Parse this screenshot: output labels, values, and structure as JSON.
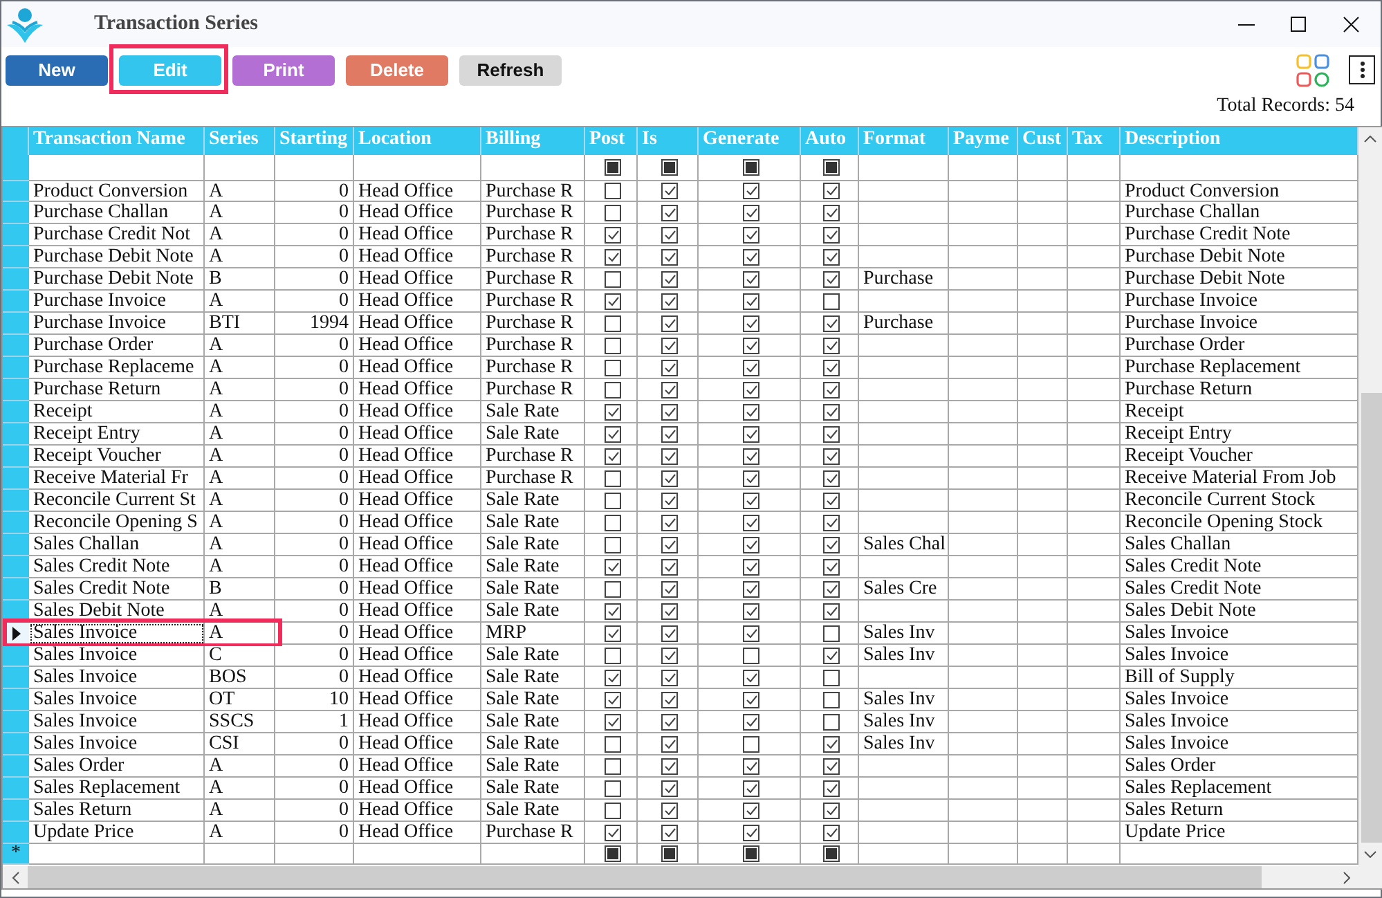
{
  "window": {
    "title": "Transaction Series"
  },
  "toolbar": {
    "buttons": [
      {
        "label": "New",
        "kind": "new",
        "highlighted": false
      },
      {
        "label": "Edit",
        "kind": "edit",
        "highlighted": true
      },
      {
        "label": "Print",
        "kind": "print",
        "highlighted": false
      },
      {
        "label": "Delete",
        "kind": "delete",
        "highlighted": false
      },
      {
        "label": "Refresh",
        "kind": "refresh",
        "highlighted": false
      }
    ]
  },
  "total_records": "Total Records: 54",
  "table": {
    "columns": [
      {
        "label": "Transaction Name",
        "kind": "text"
      },
      {
        "label": "Series",
        "kind": "text"
      },
      {
        "label": "Starting",
        "kind": "number"
      },
      {
        "label": "Location",
        "kind": "text"
      },
      {
        "label": "Billing",
        "kind": "text"
      },
      {
        "label": "Post",
        "kind": "check"
      },
      {
        "label": "Is",
        "kind": "check"
      },
      {
        "label": "Generate",
        "kind": "check"
      },
      {
        "label": "Auto",
        "kind": "check"
      },
      {
        "label": "Format",
        "kind": "text"
      },
      {
        "label": "Payme",
        "kind": "text"
      },
      {
        "label": "Cust",
        "kind": "text"
      },
      {
        "label": "Tax",
        "kind": "text"
      },
      {
        "label": "Description",
        "kind": "text"
      }
    ],
    "rows": [
      {
        "name": "Product Conversion",
        "series": "A",
        "starting": "0",
        "location": "Head Office",
        "billing": "Purchase R",
        "post": false,
        "is": true,
        "generate": true,
        "auto": true,
        "description": "Product Conversion",
        "selected": false,
        "highlighted": false
      },
      {
        "name": "Purchase Challan",
        "series": "A",
        "starting": "0",
        "location": "Head Office",
        "billing": "Purchase R",
        "post": false,
        "is": true,
        "generate": true,
        "auto": true,
        "description": "Purchase Challan",
        "selected": false,
        "highlighted": false
      },
      {
        "name": "Purchase Credit Not",
        "series": "A",
        "starting": "0",
        "location": "Head Office",
        "billing": "Purchase R",
        "post": true,
        "is": true,
        "generate": true,
        "auto": true,
        "description": "Purchase Credit Note",
        "selected": false,
        "highlighted": false
      },
      {
        "name": "Purchase Debit Note",
        "series": "A",
        "starting": "0",
        "location": "Head Office",
        "billing": "Purchase R",
        "post": true,
        "is": true,
        "generate": true,
        "auto": true,
        "description": "Purchase Debit Note",
        "selected": false,
        "highlighted": false
      },
      {
        "name": "Purchase Debit Note",
        "series": "B",
        "starting": "0",
        "location": "Head Office",
        "billing": "Purchase R",
        "post": false,
        "is": true,
        "generate": true,
        "auto": true,
        "format": "Purchase",
        "description": "Purchase Debit Note",
        "selected": false,
        "highlighted": false
      },
      {
        "name": "Purchase Invoice",
        "series": "A",
        "starting": "0",
        "location": "Head Office",
        "billing": "Purchase R",
        "post": true,
        "is": true,
        "generate": true,
        "auto": false,
        "description": "Purchase Invoice",
        "selected": false,
        "highlighted": false
      },
      {
        "name": "Purchase Invoice",
        "series": "BTI",
        "starting": "1994",
        "location": "Head Office",
        "billing": "Purchase R",
        "post": false,
        "is": true,
        "generate": true,
        "auto": true,
        "format": "Purchase",
        "description": "Purchase Invoice",
        "selected": false,
        "highlighted": false
      },
      {
        "name": "Purchase Order",
        "series": "A",
        "starting": "0",
        "location": "Head Office",
        "billing": "Purchase R",
        "post": false,
        "is": true,
        "generate": true,
        "auto": true,
        "description": "Purchase Order",
        "selected": false,
        "highlighted": false
      },
      {
        "name": "Purchase Replaceme",
        "series": "A",
        "starting": "0",
        "location": "Head Office",
        "billing": "Purchase R",
        "post": false,
        "is": true,
        "generate": true,
        "auto": true,
        "description": "Purchase Replacement",
        "selected": false,
        "highlighted": false
      },
      {
        "name": "Purchase Return",
        "series": "A",
        "starting": "0",
        "location": "Head Office",
        "billing": "Purchase R",
        "post": false,
        "is": true,
        "generate": true,
        "auto": true,
        "description": "Purchase Return",
        "selected": false,
        "highlighted": false
      },
      {
        "name": "Receipt",
        "series": "A",
        "starting": "0",
        "location": "Head Office",
        "billing": "Sale Rate",
        "post": true,
        "is": true,
        "generate": true,
        "auto": true,
        "description": "Receipt",
        "selected": false,
        "highlighted": false
      },
      {
        "name": "Receipt Entry",
        "series": "A",
        "starting": "0",
        "location": "Head Office",
        "billing": "Sale Rate",
        "post": true,
        "is": true,
        "generate": true,
        "auto": true,
        "description": "Receipt Entry",
        "selected": false,
        "highlighted": false
      },
      {
        "name": "Receipt Voucher",
        "series": "A",
        "starting": "0",
        "location": "Head Office",
        "billing": "Purchase R",
        "post": true,
        "is": true,
        "generate": true,
        "auto": true,
        "description": "Receipt Voucher",
        "selected": false,
        "highlighted": false
      },
      {
        "name": "Receive Material Fr",
        "series": "A",
        "starting": "0",
        "location": "Head Office",
        "billing": "Purchase R",
        "post": false,
        "is": true,
        "generate": true,
        "auto": true,
        "description": "Receive Material From Job",
        "selected": false,
        "highlighted": false
      },
      {
        "name": "Reconcile Current St",
        "series": "A",
        "starting": "0",
        "location": "Head Office",
        "billing": "Sale Rate",
        "post": false,
        "is": true,
        "generate": true,
        "auto": true,
        "description": "Reconcile Current Stock",
        "selected": false,
        "highlighted": false
      },
      {
        "name": "Reconcile Opening S",
        "series": "A",
        "starting": "0",
        "location": "Head Office",
        "billing": "Sale Rate",
        "post": false,
        "is": true,
        "generate": true,
        "auto": true,
        "description": "Reconcile Opening Stock",
        "selected": false,
        "highlighted": false
      },
      {
        "name": "Sales Challan",
        "series": "A",
        "starting": "0",
        "location": "Head Office",
        "billing": "Sale Rate",
        "post": false,
        "is": true,
        "generate": true,
        "auto": true,
        "format": "Sales Chal",
        "description": "Sales Challan",
        "selected": false,
        "highlighted": false
      },
      {
        "name": "Sales Credit Note",
        "series": "A",
        "starting": "0",
        "location": "Head Office",
        "billing": "Sale Rate",
        "post": true,
        "is": true,
        "generate": true,
        "auto": true,
        "description": "Sales Credit Note",
        "selected": false,
        "highlighted": false
      },
      {
        "name": "Sales Credit Note",
        "series": "B",
        "starting": "0",
        "location": "Head Office",
        "billing": "Sale Rate",
        "post": false,
        "is": true,
        "generate": true,
        "auto": true,
        "format": "Sales Cre",
        "description": "Sales Credit Note",
        "selected": false,
        "highlighted": false
      },
      {
        "name": "Sales Debit Note",
        "series": "A",
        "starting": "0",
        "location": "Head Office",
        "billing": "Sale Rate",
        "post": true,
        "is": true,
        "generate": true,
        "auto": true,
        "description": "Sales Debit Note",
        "selected": false,
        "highlighted": false
      },
      {
        "name": "Sales Invoice",
        "series": "A",
        "starting": "0",
        "location": "Head Office",
        "billing": "MRP",
        "post": true,
        "is": true,
        "generate": true,
        "auto": false,
        "format": "Sales Inv",
        "description": "Sales Invoice",
        "selected": true,
        "highlighted": true
      },
      {
        "name": "Sales Invoice",
        "series": "C",
        "starting": "0",
        "location": "Head Office",
        "billing": "Sale Rate",
        "post": false,
        "is": true,
        "generate": false,
        "auto": true,
        "format": "Sales Inv",
        "description": "Sales Invoice",
        "selected": false,
        "highlighted": false
      },
      {
        "name": "Sales Invoice",
        "series": "BOS",
        "starting": "0",
        "location": "Head Office",
        "billing": "Sale Rate",
        "post": true,
        "is": true,
        "generate": true,
        "auto": false,
        "description": "Bill of Supply",
        "selected": false,
        "highlighted": false
      },
      {
        "name": "Sales Invoice",
        "series": "OT",
        "starting": "10",
        "location": "Head Office",
        "billing": "Sale Rate",
        "post": true,
        "is": true,
        "generate": true,
        "auto": false,
        "format": "Sales Inv",
        "description": "Sales Invoice",
        "selected": false,
        "highlighted": false
      },
      {
        "name": "Sales Invoice",
        "series": "SSCS",
        "starting": "1",
        "location": "Head Office",
        "billing": "Sale Rate",
        "post": true,
        "is": true,
        "generate": true,
        "auto": false,
        "format": "Sales Inv",
        "description": "Sales Invoice",
        "selected": false,
        "highlighted": false
      },
      {
        "name": "Sales Invoice",
        "series": "CSI",
        "starting": "0",
        "location": "Head Office",
        "billing": "Sale Rate",
        "post": false,
        "is": true,
        "generate": false,
        "auto": true,
        "format": "Sales Inv",
        "description": "Sales Invoice",
        "selected": false,
        "highlighted": false
      },
      {
        "name": "Sales Order",
        "series": "A",
        "starting": "0",
        "location": "Head Office",
        "billing": "Sale Rate",
        "post": false,
        "is": true,
        "generate": true,
        "auto": true,
        "description": "Sales Order",
        "selected": false,
        "highlighted": false
      },
      {
        "name": "Sales Replacement",
        "series": "A",
        "starting": "0",
        "location": "Head Office",
        "billing": "Sale Rate",
        "post": false,
        "is": true,
        "generate": true,
        "auto": true,
        "description": "Sales Replacement",
        "selected": false,
        "highlighted": false
      },
      {
        "name": "Sales Return",
        "series": "A",
        "starting": "0",
        "location": "Head Office",
        "billing": "Sale Rate",
        "post": false,
        "is": true,
        "generate": true,
        "auto": true,
        "description": "Sales Return",
        "selected": false,
        "highlighted": false
      },
      {
        "name": "Update Price",
        "series": "A",
        "starting": "0",
        "location": "Head Office",
        "billing": "Purchase R",
        "post": true,
        "is": true,
        "generate": true,
        "auto": true,
        "description": "Update Price",
        "selected": false,
        "highlighted": false
      }
    ],
    "filter_row": {
      "checks": [
        {
          "indeterminate": true
        },
        {
          "indeterminate": true
        },
        {
          "indeterminate": true
        },
        {
          "indeterminate": true
        }
      ]
    },
    "new_row": {
      "marker": "*",
      "checks": [
        {
          "indeterminate": true
        },
        {
          "indeterminate": true
        },
        {
          "indeterminate": true
        },
        {
          "indeterminate": true
        }
      ]
    }
  }
}
